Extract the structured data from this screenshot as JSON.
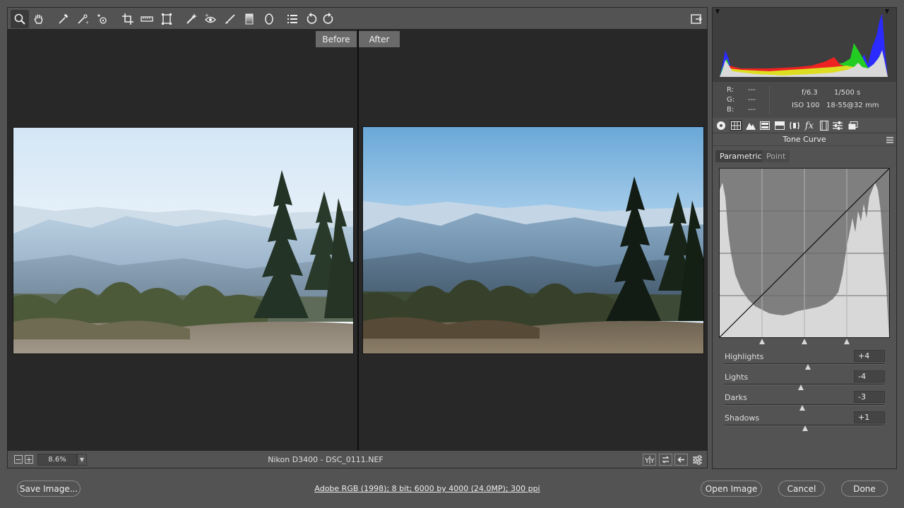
{
  "toolbar": {
    "tools": [
      {
        "name": "zoom-tool-icon",
        "active": true
      },
      {
        "name": "hand-tool-icon"
      },
      {
        "name": "white-balance-tool-icon"
      },
      {
        "name": "color-sampler-tool-icon"
      },
      {
        "name": "targeted-adjustment-tool-icon"
      },
      {
        "name": "crop-tool-icon"
      },
      {
        "name": "straighten-tool-icon"
      },
      {
        "name": "transform-tool-icon"
      },
      {
        "name": "spot-removal-tool-icon"
      },
      {
        "name": "red-eye-removal-icon"
      },
      {
        "name": "adjustment-brush-icon"
      },
      {
        "name": "graduated-filter-icon"
      },
      {
        "name": "radial-filter-icon"
      },
      {
        "name": "open-preferences-icon"
      },
      {
        "name": "rotate-ccw-icon"
      },
      {
        "name": "rotate-cw-icon"
      }
    ],
    "fullscreen_icon": "toggle-fullscreen-icon"
  },
  "preview": {
    "before_label": "Before",
    "after_label": "After"
  },
  "status": {
    "zoom_value": "8.6%",
    "filename": "Nikon D3400  -  DSC_0111.NEF"
  },
  "info": {
    "r_label": "R:",
    "r_value": "---",
    "g_label": "G:",
    "g_value": "---",
    "b_label": "B:",
    "b_value": "---",
    "aperture": "f/6.3",
    "shutter": "1/500 s",
    "iso": "ISO 100",
    "lens": "18-55@32 mm"
  },
  "panel": {
    "title": "Tone Curve",
    "tab_parametric": "Parametric",
    "tab_point": "Point",
    "sliders": [
      {
        "label": "Highlights",
        "value": "+4",
        "level": 4
      },
      {
        "label": "Lights",
        "value": "-4",
        "level": -4
      },
      {
        "label": "Darks",
        "value": "-3",
        "level": -3
      },
      {
        "label": "Shadows",
        "value": "+1",
        "level": 1
      }
    ]
  },
  "bottom": {
    "save_label": "Save Image...",
    "workflow_label": "Adobe RGB (1998); 8 bit; 6000 by 4000 (24.0MP); 300 ppi",
    "open_label": "Open Image",
    "cancel_label": "Cancel",
    "done_label": "Done"
  },
  "colors": {
    "panel_bg": "#535353",
    "preview_bg": "#282828",
    "accent_tab": "#6a6a6a"
  }
}
